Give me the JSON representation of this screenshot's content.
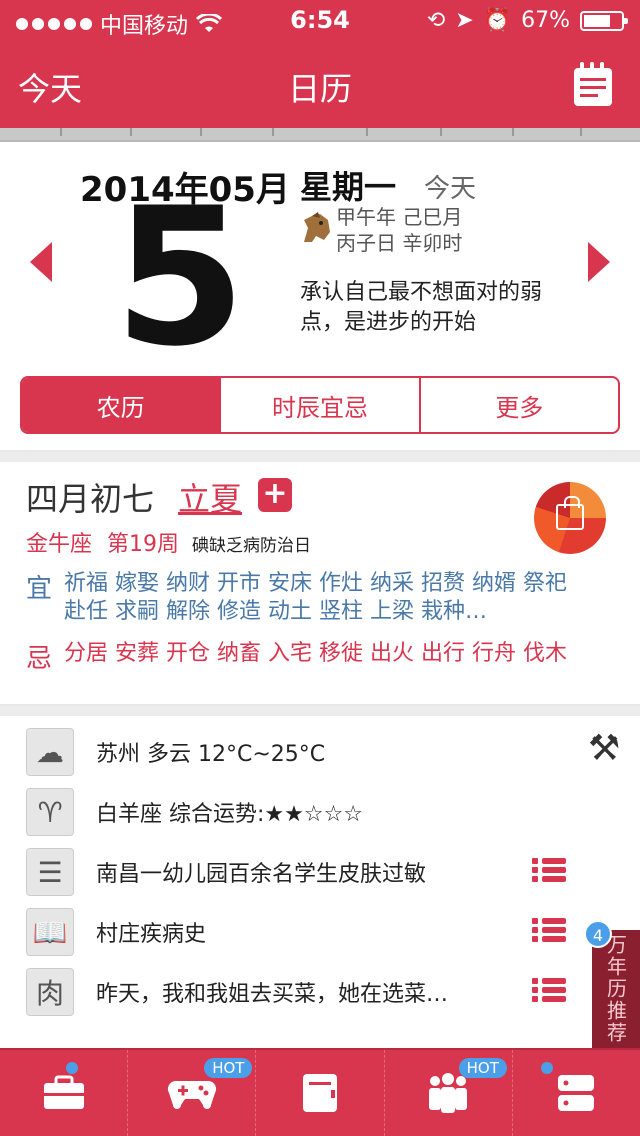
{
  "status": {
    "carrier": "中国移动",
    "time": "6:54",
    "battery": "67%"
  },
  "nav": {
    "left": "今天",
    "title": "日历"
  },
  "date": {
    "year_month": "2014年05月",
    "day": "5",
    "weekday": "星期一",
    "today_tag": "今天",
    "ganzhi_line1": "甲午年 己巳月",
    "ganzhi_line2": "丙子日 辛卯时",
    "quote": "承认自己最不想面对的弱点，是进步的开始"
  },
  "tabs": [
    {
      "label": "农历",
      "active": true
    },
    {
      "label": "时辰宜忌",
      "active": false
    },
    {
      "label": "更多",
      "active": false
    }
  ],
  "lunar": {
    "date": "四月初七",
    "solar_term": "立夏",
    "zodiac": "金牛座",
    "week": "第19周",
    "health_day": "碘缺乏病防治日",
    "yi_label": "宜",
    "yi": "祈福 嫁娶 纳财 开市 安床 作灶 纳采 招赘 纳婿 祭祀 赴任 求嗣 解除 修造 动土 竖柱 上梁 栽种…",
    "ji_label": "忌",
    "ji": "分居 安葬 开仓 纳畜 入宅 移徙 出火 出行 行舟 伐木"
  },
  "info": [
    {
      "icon": "cloud-icon",
      "text": "苏州 多云 12°C~25°C"
    },
    {
      "icon": "aries-icon",
      "text": "白羊座 综合运势:★★☆☆☆"
    },
    {
      "icon": "news-icon",
      "text": "南昌一幼儿园百余名学生皮肤过敏"
    },
    {
      "icon": "book-icon",
      "text": "村庄疾病史"
    },
    {
      "icon": "joke-icon",
      "text": "昨天，我和我姐去买菜，她在选菜…"
    }
  ],
  "recommend": {
    "label": "万年历推荐",
    "badge": "4"
  },
  "tabbar": {
    "hot1": "HOT",
    "hot2": "HOT"
  },
  "colors": {
    "accent": "#d8364f",
    "blue": "#4a79a8",
    "badge": "#4a9fe8"
  }
}
